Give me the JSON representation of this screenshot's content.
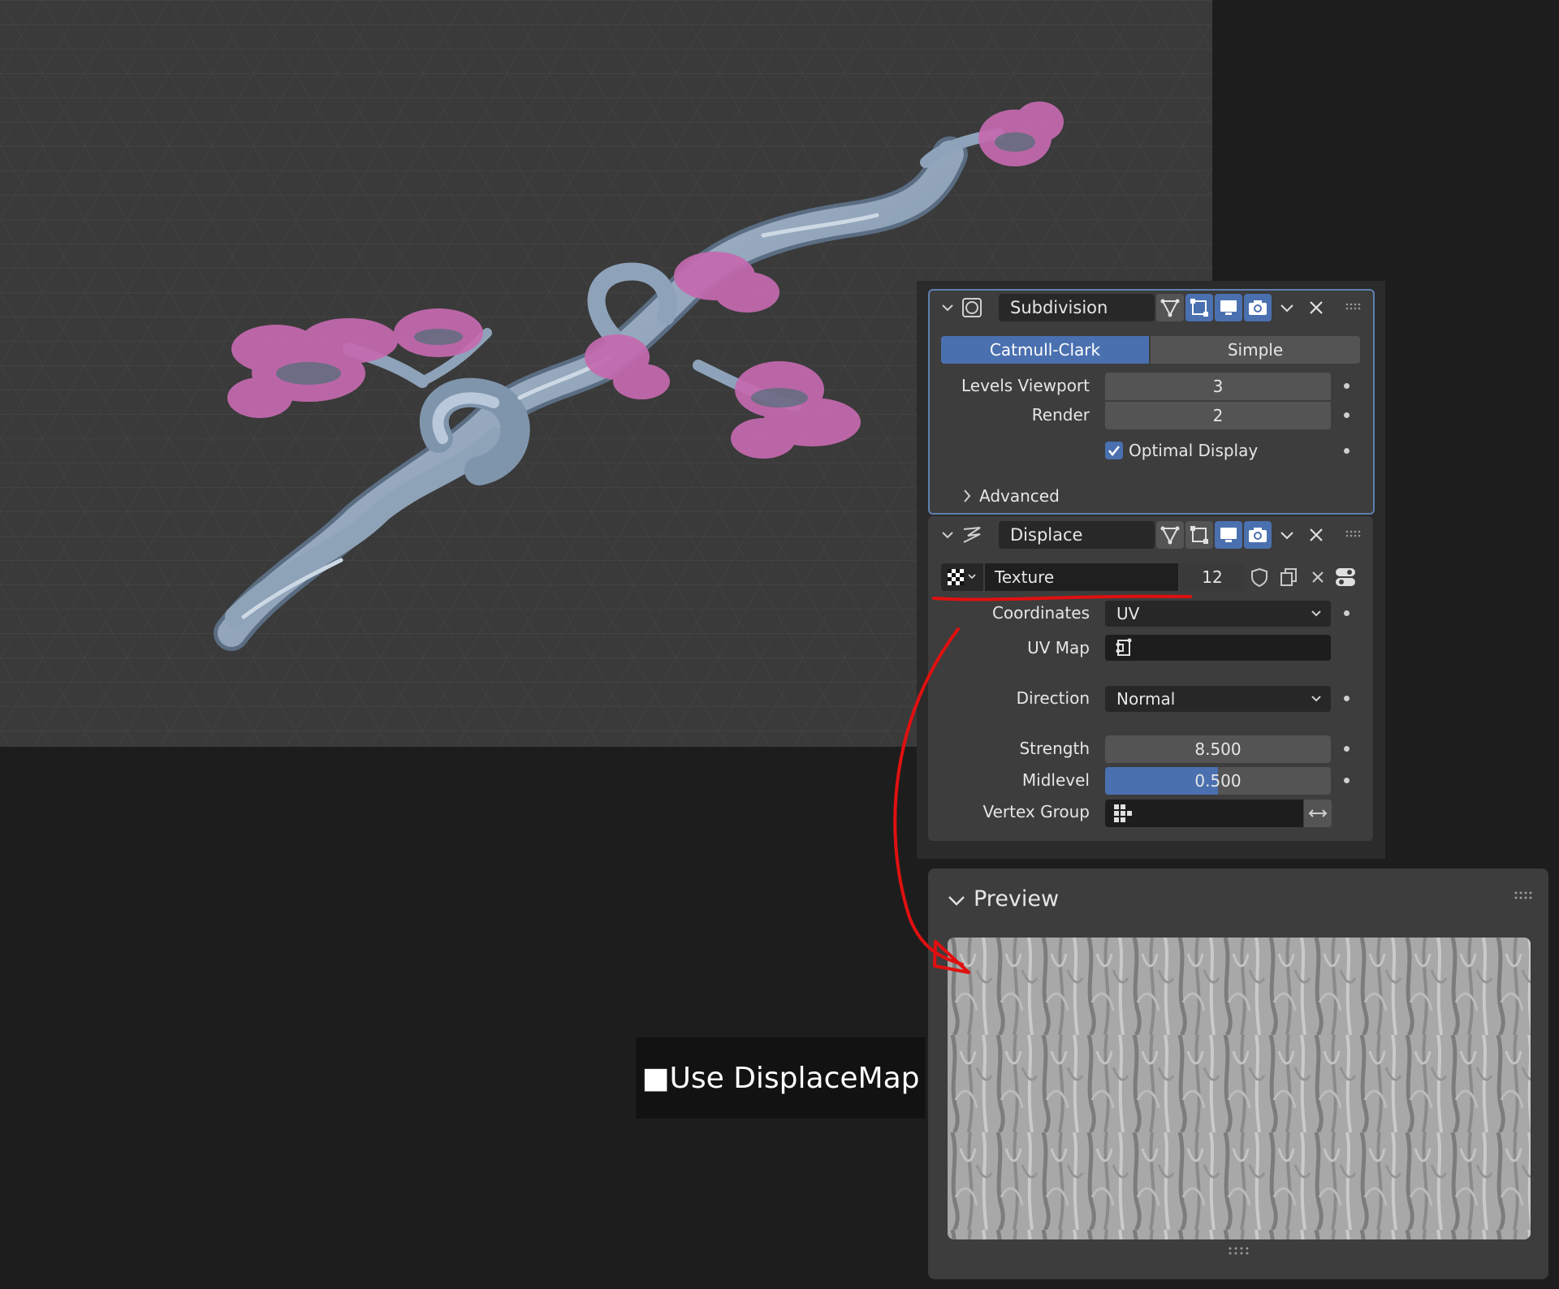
{
  "caption": {
    "text": "■Use DisplaceMap"
  },
  "subdivision": {
    "name": "Subdivision",
    "modes": [
      "Catmull-Clark",
      "Simple"
    ],
    "active_mode": "Catmull-Clark",
    "levels_viewport_label": "Levels Viewport",
    "levels_viewport_value": "3",
    "render_label": "Render",
    "render_value": "2",
    "optimal_display_label": "Optimal Display",
    "optimal_display_checked": true,
    "advanced_label": "Advanced"
  },
  "displace": {
    "name": "Displace",
    "texture_name": "Texture",
    "texture_users": "12",
    "coordinates_label": "Coordinates",
    "coordinates_value": "UV",
    "uvmap_label": "UV Map",
    "uvmap_value": "",
    "direction_label": "Direction",
    "direction_value": "Normal",
    "strength_label": "Strength",
    "strength_value": "8.500",
    "midlevel_label": "Midlevel",
    "midlevel_value": "0.500",
    "midlevel_fraction": 0.5,
    "vertex_group_label": "Vertex Group",
    "vertex_group_value": ""
  },
  "preview": {
    "title": "Preview"
  },
  "colors": {
    "accent": "#4a70b0",
    "annotation_red": "#e01010",
    "panel_bg": "#3d3d3d",
    "viewport_bg": "#3a3a3a"
  }
}
